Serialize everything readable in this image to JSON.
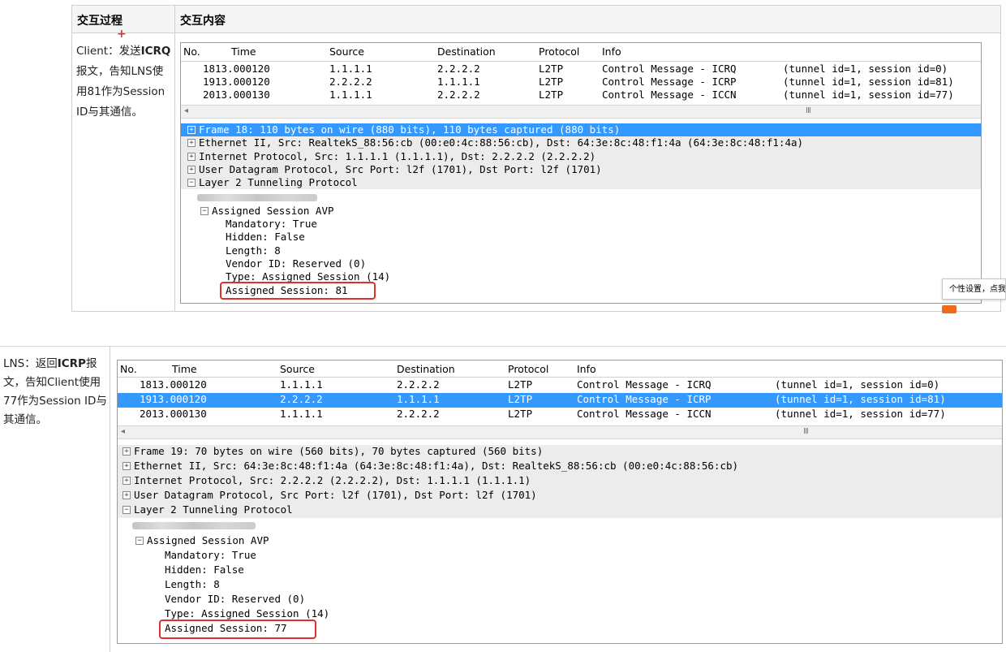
{
  "doc": {
    "col_process": "交互过程",
    "col_content": "交互内容",
    "plus": "+",
    "step1": {
      "prefix": "Client：发送",
      "bold": "ICRQ",
      "suffix": "报文，告知LNS使用81作为Session ID与其通信。"
    },
    "step2": {
      "prefix": "LNS：返回",
      "bold": "ICRP",
      "suffix": "报文，告知Client使用77作为Session ID与其通信。"
    }
  },
  "columns": {
    "no": "No.",
    "time": "Time",
    "source": "Source",
    "destination": "Destination",
    "protocol": "Protocol",
    "info": "Info"
  },
  "packets": [
    {
      "no": "18",
      "time": "13.000120",
      "source": "1.1.1.1",
      "destination": "2.2.2.2",
      "protocol": "L2TP",
      "info": "Control Message - ICRQ",
      "extra": "(tunnel id=1, session id=0)"
    },
    {
      "no": "19",
      "time": "13.000120",
      "source": "2.2.2.2",
      "destination": "1.1.1.1",
      "protocol": "L2TP",
      "info": "Control Message - ICRP",
      "extra": "(tunnel id=1, session id=81)"
    },
    {
      "no": "20",
      "time": "13.000130",
      "source": "1.1.1.1",
      "destination": "2.2.2.2",
      "protocol": "L2TP",
      "info": "Control Message - ICCN",
      "extra": "(tunnel id=1, session id=77)"
    }
  ],
  "scroll_mark": "III",
  "pane1": {
    "tree": [
      "Frame 18: 110 bytes on wire (880 bits), 110 bytes captured (880 bits)",
      "Ethernet II, Src: RealtekS_88:56:cb (00:e0:4c:88:56:cb), Dst: 64:3e:8c:48:f1:4a (64:3e:8c:48:f1:4a)",
      "Internet Protocol, Src: 1.1.1.1 (1.1.1.1), Dst: 2.2.2.2 (2.2.2.2)",
      "User Datagram Protocol, Src Port: l2f (1701), Dst Port: l2f (1701)",
      "Layer 2 Tunneling Protocol"
    ],
    "avp": "Assigned Session AVP",
    "fields": [
      "Mandatory: True",
      "Hidden: False",
      "Length: 8",
      "Vendor ID: Reserved (0)",
      "Type: Assigned Session (14)"
    ],
    "assigned": "Assigned Session: 81"
  },
  "pane2": {
    "tree": [
      "Frame 19: 70 bytes on wire (560 bits), 70 bytes captured (560 bits)",
      "Ethernet II, Src: 64:3e:8c:48:f1:4a (64:3e:8c:48:f1:4a), Dst: RealtekS_88:56:cb (00:e0:4c:88:56:cb)",
      "Internet Protocol, Src: 2.2.2.2 (2.2.2.2), Dst: 1.1.1.1 (1.1.1.1)",
      "User Datagram Protocol, Src Port: l2f (1701), Dst Port: l2f (1701)",
      "Layer 2 Tunneling Protocol"
    ],
    "avp": "Assigned Session AVP",
    "fields": [
      "Mandatory: True",
      "Hidden: False",
      "Length: 8",
      "Vendor ID: Reserved (0)",
      "Type: Assigned Session (14)"
    ],
    "assigned": "Assigned Session: 77"
  },
  "tooltip": "个性设置，点我",
  "colors": {
    "selection": "#3399ff",
    "highlight_box": "#e0302e"
  }
}
